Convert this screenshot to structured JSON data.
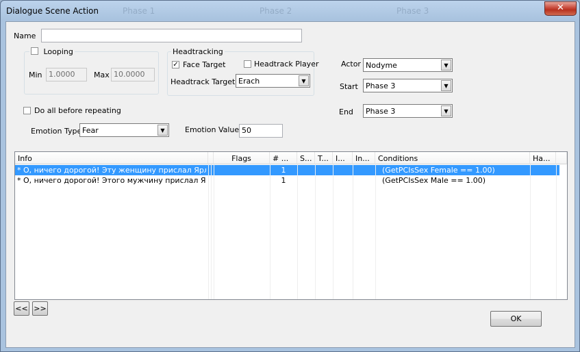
{
  "window": {
    "title": "Dialogue Scene Action",
    "ghost_tabs": [
      "Phase 1",
      "Phase 2",
      "Phase 3"
    ],
    "close_glyph": "✕"
  },
  "name": {
    "label": "Name",
    "value": ""
  },
  "looping": {
    "label": "Looping",
    "checked": false,
    "min_label": "Min",
    "min_value": "1.0000",
    "max_label": "Max",
    "max_value": "10.0000"
  },
  "headtracking": {
    "title": "Headtracking",
    "face_target_label": "Face Target",
    "face_target_checked": true,
    "headtrack_player_label": "Headtrack Player",
    "headtrack_player_checked": false,
    "target_label": "Headtrack Target",
    "target_value": "Erach"
  },
  "actor": {
    "label": "Actor",
    "value": "Nodyme"
  },
  "start": {
    "label": "Start",
    "value": "Phase 3"
  },
  "end": {
    "label": "End",
    "value": "Phase 3"
  },
  "do_all": {
    "label": "Do all before repeating",
    "checked": false
  },
  "emotion": {
    "type_label": "Emotion Type",
    "type_value": "Fear",
    "value_label": "Emotion Value",
    "value": "50"
  },
  "table": {
    "columns": [
      "Info",
      "Flags",
      "# ...",
      "S...",
      "T...",
      "I...",
      "In...",
      "Conditions",
      "Ha..."
    ],
    "rows": [
      {
        "info": "* О, ничего дорогой! Эту женщину прислал Ярл, ч...",
        "flags": "",
        "count": "1",
        "conditions": "(GetPCIsSex Female == 1.00)",
        "selected": true
      },
      {
        "info": "* О, ничего дорогой! Этого мужчину прислал Ярл, ...",
        "flags": "",
        "count": "1",
        "conditions": "(GetPCIsSex Male == 1.00)",
        "selected": false
      }
    ]
  },
  "nav": {
    "prev": "<<",
    "next": ">>"
  },
  "ok_label": "OK",
  "colors": {
    "selection": "#3399ff",
    "title_bar": "#a9c3df",
    "close": "#c8493a"
  }
}
